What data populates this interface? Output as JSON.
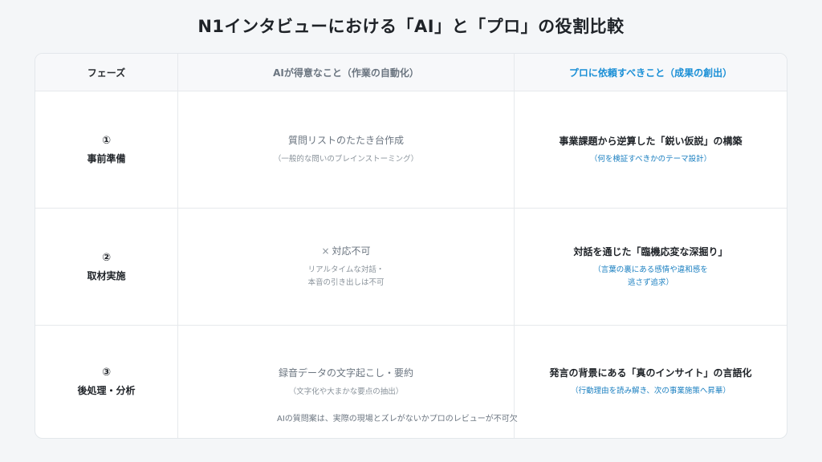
{
  "title": "N1インタビューにおける「AI」と「プロ」の役割比較",
  "table": {
    "headers": {
      "phase": "フェーズ",
      "ai": "AIが得意なこと（作業の自動化）",
      "pro": "プロに依頼すべきこと（成果の創出）"
    },
    "rows": [
      {
        "num": "①",
        "phase": "事前準備",
        "ai_icon": "",
        "ai_main": "質問リストのたたき台作成",
        "ai_sub": "（一般的な問いのブレインストーミング）",
        "pro_main": "事業課題から逆算した「鋭い仮説」の構築",
        "pro_sub": "（何を検証すべきかのテーマ設計）"
      },
      {
        "num": "②",
        "phase": "取材実施",
        "ai_icon": "×",
        "ai_main": "対応不可",
        "ai_sub": "リアルタイムな対話・\n本音の引き出しは不可",
        "pro_main": "対話を通じた「臨機応変な深掘り」",
        "pro_sub": "（言葉の裏にある感情や違和感を\n逃さず追求）"
      },
      {
        "num": "③",
        "phase": "後処理・分析",
        "ai_icon": "",
        "ai_main": "録音データの文字起こし・要約",
        "ai_sub": "（文字化や大まかな要点の抽出）",
        "pro_main": "発言の背景にある「真のインサイト」の言語化",
        "pro_sub": "（行動理由を読み解き、次の事業施策へ昇華）"
      }
    ]
  },
  "footnote": "AIの質問案は、実際の現場とズレがないかプロのレビューが不可欠",
  "colors": {
    "accent_blue": "#1a8fd6",
    "header_bg": "#f7f8fa",
    "page_bg": "#f4f6f8"
  }
}
